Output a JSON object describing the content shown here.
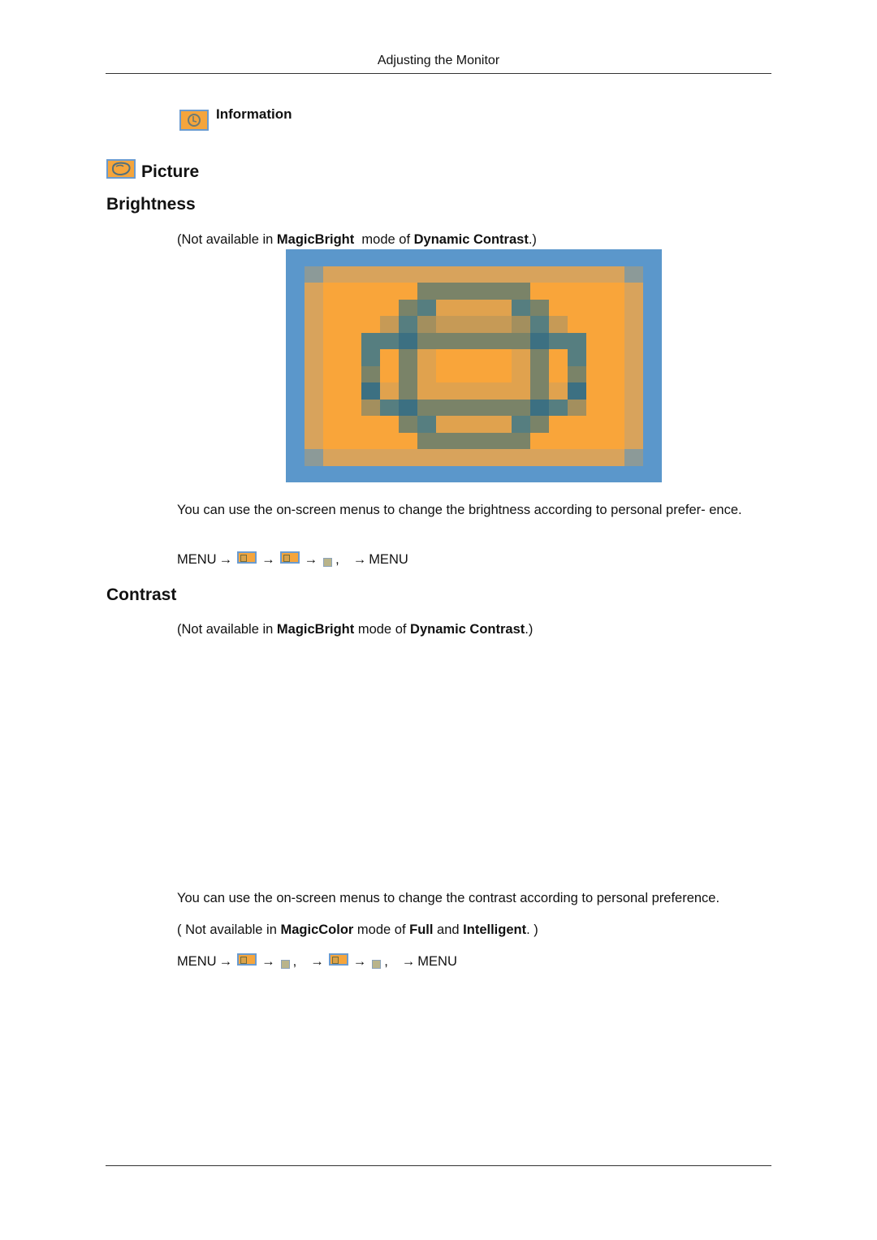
{
  "header": {
    "running_title": "Adjusting the Monitor"
  },
  "info_item": {
    "icon": "clock-icon",
    "label": "Information"
  },
  "section": {
    "icon": "picture-icon",
    "title": "Picture"
  },
  "brightness": {
    "heading": "Brightness",
    "note": {
      "prefix": "(Not available in ",
      "bold1": "MagicBright",
      "middle": "  mode of ",
      "bold2": "Dynamic Contrast",
      "suffix": ".)"
    },
    "picture_icon": {
      "name": "brightness-picture-icon",
      "palette": {
        "B": "#5b97cb",
        "G": "#8c9a98",
        "T": "#d8a35c",
        "O": "#f9a53a",
        "o": "#e0a24e",
        "K": "#7a8368",
        "k": "#a38f5e",
        "L": "#567e80",
        "D": "#3c7082",
        "t": "#c69a56"
      },
      "rows": [
        "BBBBBBBBBBBBBBBBBBBB",
        "BGTTTTTTTTTTTTTTTTGB",
        "BTOOOOOKKKKKKOOOOOTB",
        "BTOOOOKLooooLKOOOOTB",
        "BTOOOtLkttttkLtOOOTB",
        "BTOOLLDKKKKKKDLLOOTB",
        "BTOOLOKoOOOOoKOLOOTB",
        "BTOOKOKoOOOOoKOKOOTB",
        "BTOODoKooooooKoDOOTB",
        "BTOOkLDKKKKKKDLkOOTB",
        "BTOOOOKLooooLKOOOOTB",
        "BTOOOOOKKKKKKOOOOOTB",
        "BGTTTTTTTTTTTTTTTTGB",
        "BBBBBBBBBBBBBBBBBBBB"
      ]
    },
    "description": "You can use the on-screen menus to change the brightness according to personal prefer- ence.",
    "menu_path": {
      "start": "MENU",
      "arrow": "→",
      "comma": ",",
      "end": "MENU"
    }
  },
  "contrast": {
    "heading": "Contrast",
    "note": {
      "prefix": "(Not available in ",
      "bold1": "MagicBright",
      "middle": " mode of ",
      "bold2": "Dynamic Contrast",
      "suffix": ".)"
    },
    "description": "You can use the on-screen menus to change the contrast according to personal preference.",
    "note2": {
      "prefix": "( Not available in ",
      "bold1": "MagicColor",
      "middle": " mode of ",
      "bold2": "Full",
      "and": " and ",
      "bold3": "Intelligent",
      "suffix": ". )"
    },
    "menu_path": {
      "start": "MENU",
      "arrow": "→",
      "comma": ",",
      "end": "MENU"
    }
  }
}
